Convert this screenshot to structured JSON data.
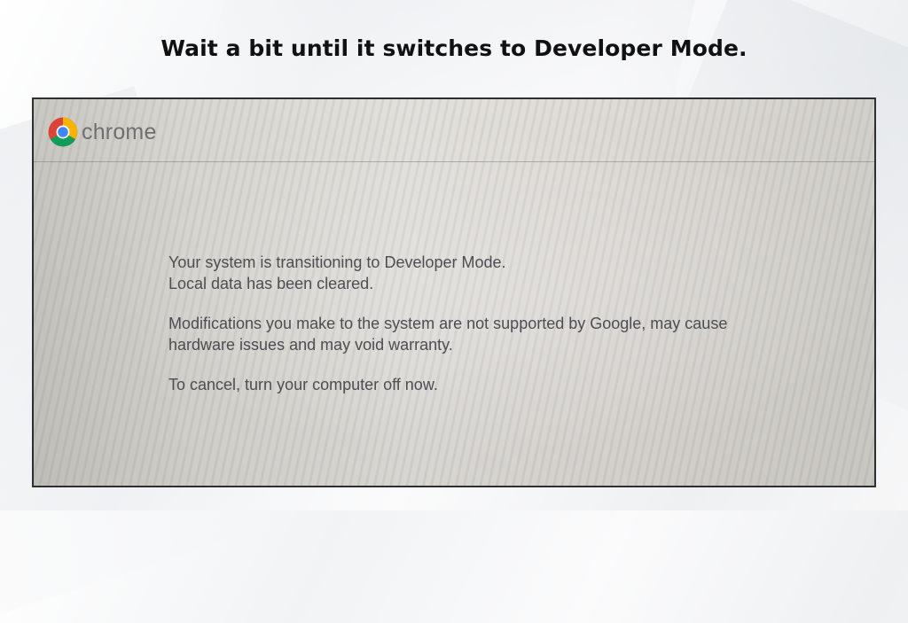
{
  "headline": "Wait a bit until it switches to Developer Mode.",
  "brand": {
    "name": "chrome",
    "icon": "chrome-logo-icon",
    "colors": {
      "red": "#DB4437",
      "green": "#0F9D58",
      "yellow": "#F4B400",
      "blue": "#4285F4"
    }
  },
  "message": {
    "p1_line1": "Your system is transitioning to Developer Mode.",
    "p1_line2": "Local data has been cleared.",
    "p2_line1": "Modifications you make to the system are not supported by Google, may cause",
    "p2_line2": "hardware issues and may void warranty.",
    "p3": "To cancel, turn your computer off now."
  }
}
